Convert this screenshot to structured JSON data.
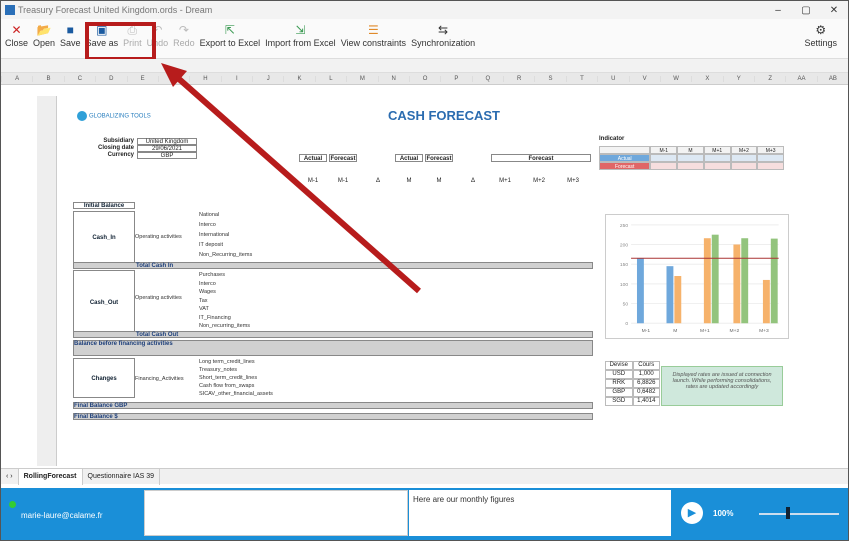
{
  "window": {
    "title": "Treasury Forecast United Kingdom.ords - Dream",
    "min": "–",
    "max": "▢",
    "close": "✕"
  },
  "toolbar": {
    "close": "Close",
    "open": "Open",
    "save": "Save",
    "save_as": "Save as",
    "print": "Print",
    "undo": "Undo",
    "redo": "Redo",
    "export": "Export to Excel",
    "import": "Import from Excel",
    "constraints": "View constraints",
    "sync": "Synchronization",
    "settings": "Settings"
  },
  "sheet": {
    "title": "CASH FORECAST",
    "logo": "GLOBALIZING TOOLS",
    "subsidiary_label": "Subsidiary",
    "subsidiary": "United Kingdom",
    "closing_label": "Closing date",
    "closing": "29/06/2021",
    "currency_label": "Currency",
    "currency": "GBP",
    "col_actual": "Actual",
    "col_forecast": "Forecast",
    "sub": [
      "M-1",
      "M-1",
      "Δ",
      "M",
      "M",
      "Δ",
      "M+1",
      "M+2",
      "M+3"
    ],
    "sections": {
      "initial": "Initial Balance",
      "cash_in": "Cash_In",
      "cash_out": "Cash_Out",
      "before_fin": "Balance before financing activities",
      "changes": "Changes",
      "final_gbp": "Final Balance GBP",
      "final_s": "Final Balance $"
    },
    "groups": {
      "op": "Operating activities",
      "fin": "Financing_Activities"
    },
    "in_rows": [
      "National",
      "Interco",
      "International",
      "IT deposit",
      "Non_Recurring_items"
    ],
    "total_in": "Total Cash In",
    "out_rows": [
      "Purchases",
      "Interco",
      "Wages",
      "Tax",
      "VAT",
      "IT_Financing",
      "Non_recurring_items"
    ],
    "total_out": "Total Cash Out",
    "chg_rows": [
      "Long term_credit_lines",
      "Treasury_notes",
      "Short_term_credit_lines",
      "Cash flow from_swaps",
      "SICAV_other_financial_assets"
    ]
  },
  "indicator": {
    "title": "Indicator",
    "cols": [
      "M-1",
      "M",
      "M+1",
      "M+2",
      "M+3"
    ],
    "actual": "Actual",
    "forecast": "Forecast"
  },
  "currencies": {
    "header": [
      "Devise",
      "Cours"
    ],
    "rows": [
      [
        "USD",
        "1,000"
      ],
      [
        "RRK",
        "6,8826"
      ],
      [
        "GBP",
        "0,6482"
      ],
      [
        "SGD",
        "1,4014"
      ]
    ]
  },
  "note": "Displayed rates are issued at connection launch. While performing consolidations, rates are updated accordingly",
  "chart_data": {
    "type": "bar",
    "categories": [
      "M-1",
      "M",
      "M+1",
      "M+2",
      "M+3"
    ],
    "ylim": [
      0,
      250
    ],
    "series": [
      {
        "values": [
          165,
          145,
          0,
          0,
          0
        ],
        "color": "#6fa8dc"
      },
      {
        "values": [
          0,
          120,
          216,
          200,
          110
        ],
        "color": "#f6b26b"
      },
      {
        "values": [
          0,
          0,
          225,
          216,
          215
        ],
        "color": "#93c47d"
      }
    ]
  },
  "tabs": [
    "RollingForecast",
    "Questionnaire IAS 39"
  ],
  "status": {
    "user": "marie-laure@calame.fr",
    "message": "Here are our monthly figures",
    "zoom": "100%"
  }
}
